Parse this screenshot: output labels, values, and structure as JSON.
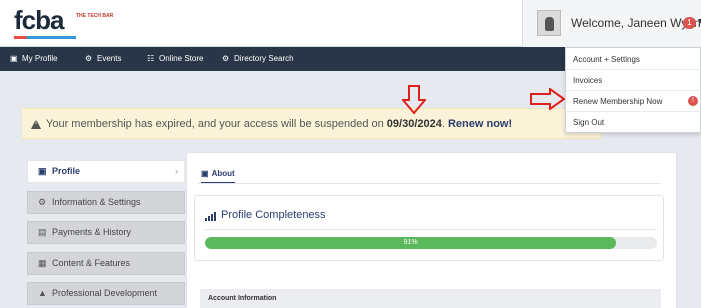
{
  "header": {
    "logo_text": "fcba",
    "logo_sub": "THE TECH BAR",
    "welcome": "Welcome, Janeen Wynn",
    "notification_count": "1"
  },
  "nav": {
    "items": [
      {
        "label": "My Profile",
        "icon": "id-card-icon"
      },
      {
        "label": "Events",
        "icon": "cogs-icon"
      },
      {
        "label": "Online Store",
        "icon": "cart-icon"
      },
      {
        "label": "Directory Search",
        "icon": "cogs-icon"
      }
    ]
  },
  "dropdown": {
    "items": [
      {
        "label": "Account + Settings"
      },
      {
        "label": "Invoices"
      },
      {
        "label": "Renew Membership Now",
        "badge": "!"
      },
      {
        "label": "Sign Out"
      }
    ]
  },
  "alert": {
    "text_before": "Your membership has expired, and your access will be suspended on ",
    "date": "09/30/2024",
    "text_after": ". ",
    "link": "Renew now!",
    "color": "#fbf3d7"
  },
  "sidebar": {
    "items": [
      {
        "label": "Profile",
        "icon": "id-card-icon",
        "active": true
      },
      {
        "label": "Information & Settings",
        "icon": "cogs-icon"
      },
      {
        "label": "Payments & History",
        "icon": "money-icon"
      },
      {
        "label": "Content & Features",
        "icon": "list-icon"
      },
      {
        "label": "Professional Development",
        "icon": "graduation-cap-icon"
      }
    ]
  },
  "main": {
    "tab_label": "About",
    "completeness_title": "Profile Completeness",
    "progress_percent": 91,
    "progress_label": "91%",
    "account_header": "Account Information"
  },
  "colors": {
    "nav_bg": "#283648",
    "accent": "#2c3e6e",
    "progress": "#5cb85c",
    "annotation": "#e0201b",
    "badge": "#d9534f"
  }
}
